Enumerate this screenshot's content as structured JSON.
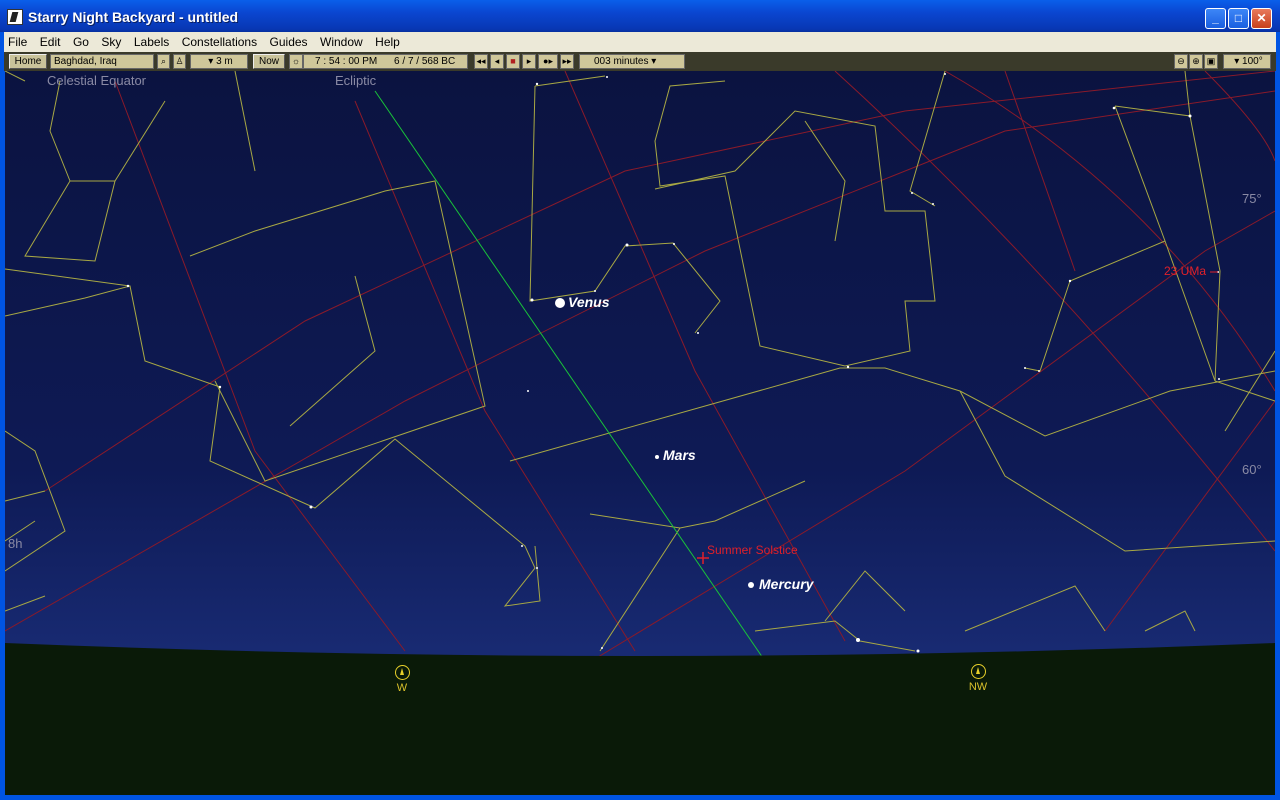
{
  "window": {
    "title": "Starry Night Backyard - untitled",
    "minimize": "_",
    "maximize": "□",
    "close": "✕"
  },
  "menu": [
    "File",
    "Edit",
    "Go",
    "Sky",
    "Labels",
    "Constellations",
    "Guides",
    "Window",
    "Help"
  ],
  "toolbar": {
    "home": "Home",
    "location": "Baghdad, Iraq",
    "elevation": "▾ 3 m",
    "now": "Now",
    "time": "7 : 54 : 00 PM",
    "date": "6 /  7 /  568 BC",
    "step": "003 minutes ▾",
    "zoom_level": "▾ 100°",
    "icons": [
      "binoculars-icon",
      "telescope-icon",
      "sun-icon",
      "rewind-icon",
      "step-back-icon",
      "stop-icon",
      "step-forward-icon",
      "fast-forward-icon",
      "end-icon",
      "zoom-out-icon",
      "zoom-in-icon",
      "fit-icon"
    ]
  },
  "sky": {
    "guides": [
      "Celestial Equator",
      "Ecliptic"
    ],
    "labels": {
      "summer_solstice": "Summer Solstice",
      "star": "23 UMa",
      "ra": "8h",
      "alt_75": "75°",
      "alt_60": "60°"
    },
    "planets": [
      "Venus",
      "Mars",
      "Mercury"
    ],
    "compass": [
      "W",
      "NW"
    ],
    "colors": {
      "constellation_lines": "#b8b84a",
      "ecliptic": "#19c23a",
      "grid": "#8a1a2a",
      "label_red": "#e0202a",
      "horizon": "#0a1a08"
    }
  }
}
